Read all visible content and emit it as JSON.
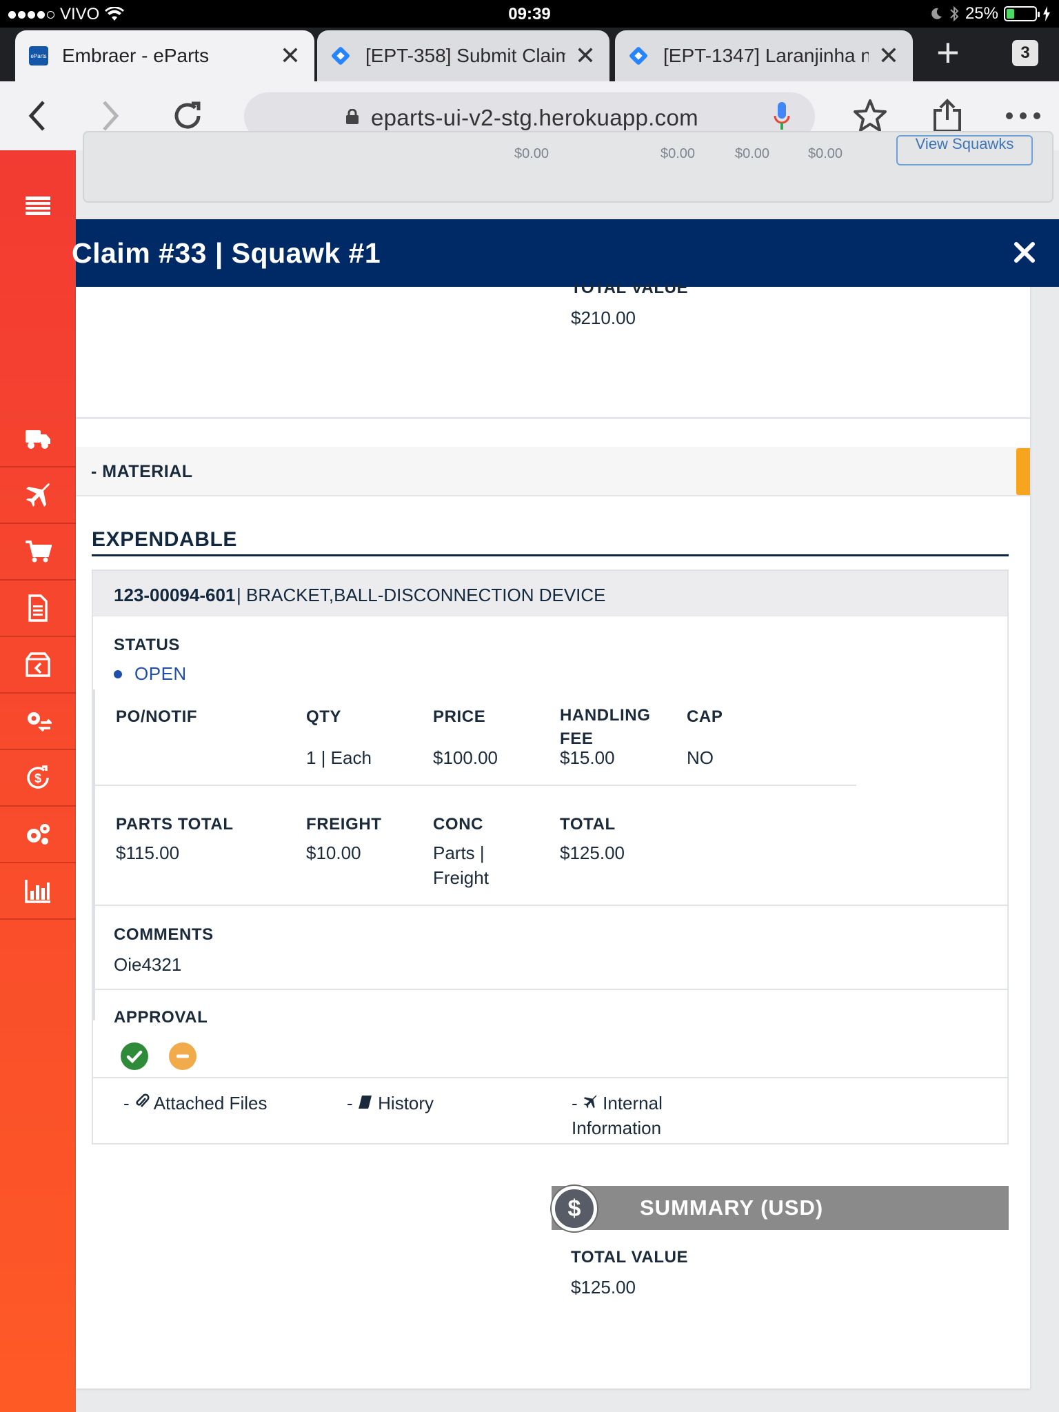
{
  "status_bar": {
    "carrier": "VIVO",
    "time": "09:39",
    "battery_percent": "25%",
    "battery_level": 0.25
  },
  "tabs": [
    {
      "title": "Embraer - eParts",
      "active": true,
      "favicon": "eparts-logo-icon",
      "favicon_text": "eParts"
    },
    {
      "title": "[EPT-358] Submit Claim",
      "active": false,
      "favicon": "jira-icon"
    },
    {
      "title": "[EPT-1347] Laranjinha n",
      "active": false,
      "favicon": "jira-icon"
    }
  ],
  "tab_count": "3",
  "address_bar": {
    "url": "eparts-ui-v2-stg.herokuapp.com"
  },
  "sidebar": {
    "icons": [
      "menu-icon",
      "truck-icon",
      "airplane-icon",
      "cart-icon",
      "document-icon",
      "box-return-icon",
      "gears-exchange-icon",
      "dollar-refresh-icon",
      "settings-icon",
      "bar-chart-icon"
    ]
  },
  "background_page": {
    "values": [
      "$0.00",
      "$0.00",
      "$0.00",
      "$0.00"
    ],
    "button_label": "View Squawks"
  },
  "modal": {
    "title": "Claim #33 | Squawk #1",
    "prev_summary": {
      "label": "TOTAL VALUE",
      "value": "$210.00"
    },
    "section_title": "- MATERIAL",
    "subsection_title": "EXPENDABLE",
    "item": {
      "part_number": "123-00094-601",
      "description": "| BRACKET,BALL-DISCONNECTION DEVICE",
      "status_label": "STATUS",
      "status_value": "OPEN",
      "po_notif_label": "PO/NOTIF",
      "po_notif_value": "",
      "qty_label": "QTY",
      "qty_value": "1 | Each",
      "price_label": "PRICE",
      "price_value": "$100.00",
      "handling_fee_label_1": "HANDLING",
      "handling_fee_label_2": "FEE",
      "handling_fee_value": "$15.00",
      "cap_label": "CAP",
      "cap_value": "NO",
      "parts_total_label": "PARTS TOTAL",
      "parts_total_value": "$115.00",
      "freight_label": "FREIGHT",
      "freight_value": "$10.00",
      "conc_label": "CONC",
      "conc_value_1": "Parts |",
      "conc_value_2": "Freight",
      "total_label": "TOTAL",
      "total_value": "$125.00",
      "comments_label": "COMMENTS",
      "comments_value": "Oie4321",
      "approval_label": "APPROVAL",
      "approval_states": [
        "approved",
        "pending"
      ],
      "links": {
        "attached_files": "Attached Files",
        "history": "History",
        "internal_info_1": "Internal",
        "internal_info_2": "Information",
        "prefix": "-"
      }
    },
    "summary": {
      "title": "SUMMARY (USD)",
      "icon_glyph": "$",
      "total_label": "TOTAL VALUE",
      "total_value": "$125.00"
    }
  },
  "colors": {
    "sidebar": "#fe5a26",
    "modal_header": "#002a66",
    "section_accent": "#f7a51f",
    "status_open": "#1f4fa8",
    "approve_ok": "#2e8b3a",
    "approve_pending": "#f1ab4b",
    "summary_bar": "#8a8a8a"
  }
}
